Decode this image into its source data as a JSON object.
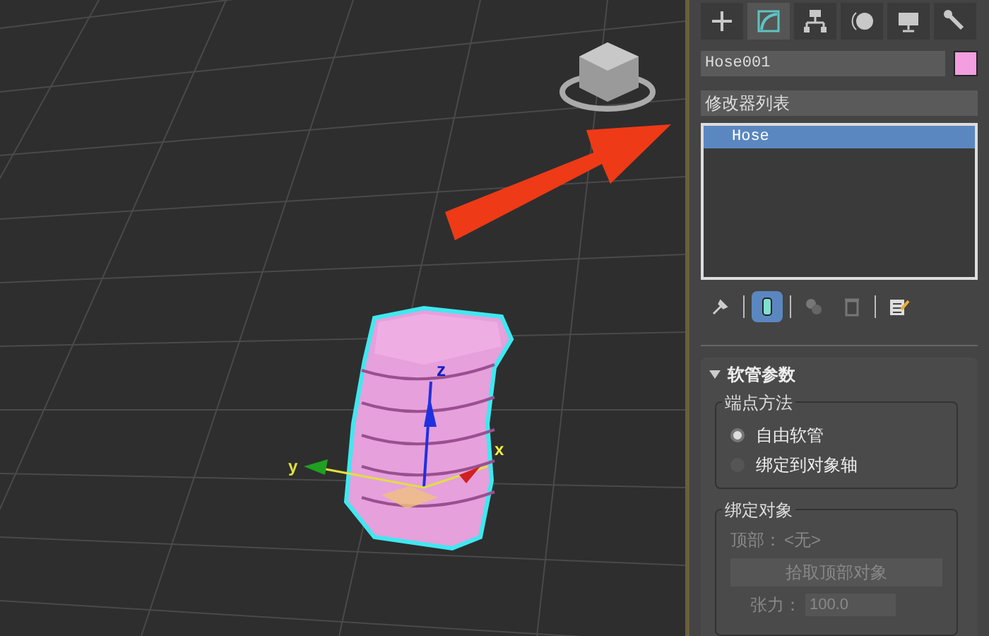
{
  "viewport": {
    "gizmo_labels": [
      "y",
      "x",
      "z"
    ]
  },
  "command_panel": {
    "tabs": [
      {
        "selected": false
      },
      {
        "selected": true
      },
      {
        "selected": false
      },
      {
        "selected": false
      },
      {
        "selected": false
      },
      {
        "selected": false
      }
    ],
    "object_name": "Hose001",
    "modifier_list": "修改器列表",
    "stack": [
      {
        "label": "Hose",
        "selected": true
      }
    ],
    "stack_tools": [
      {
        "selected": false
      },
      {
        "selected": true
      },
      {
        "selected": false
      },
      {
        "selected": false
      },
      {
        "selected": false
      }
    ],
    "rollout": {
      "title": "软管参数",
      "expanded": true,
      "end_point_method": {
        "title": "端点方法",
        "options": [
          {
            "label": "自由软管",
            "selected": true
          },
          {
            "label": "绑定到对象轴",
            "selected": false
          }
        ]
      },
      "binding_objects": {
        "title": "绑定对象",
        "top_label": "顶部：",
        "top_value": "<无>",
        "pick_button": "拾取顶部对象",
        "tension_label": "张力：",
        "tension_value": "100.0"
      }
    }
  }
}
